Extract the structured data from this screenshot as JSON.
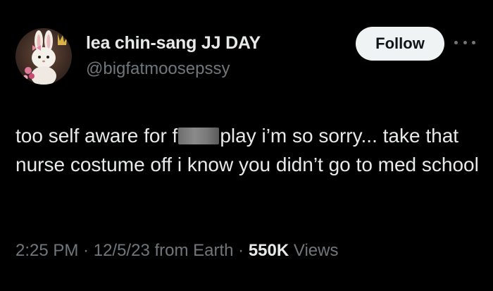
{
  "author": {
    "display_name": "lea chin-sang JJ DAY",
    "handle": "@bigfatmoosepssy"
  },
  "actions": {
    "follow_label": "Follow",
    "more_icon": "more-horizontal-icon"
  },
  "tweet": {
    "text_before_redaction": "too self aware for f",
    "text_after_redaction": "play i’m so sorry... take that nurse costume off i know you didn’t go to med school"
  },
  "meta": {
    "time": "2:25 PM",
    "separator": " · ",
    "date": "12/5/23",
    "source": " from Earth",
    "views_count": "550K",
    "views_label": " Views"
  },
  "colors": {
    "background": "#000000",
    "primary_text": "#e7e9ea",
    "secondary_text": "#71767b",
    "follow_button_bg": "#eff3f4",
    "follow_button_text": "#0f1419"
  }
}
